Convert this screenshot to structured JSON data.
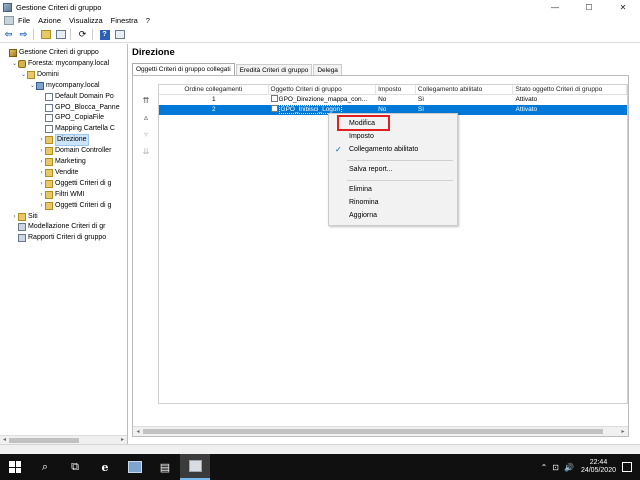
{
  "window": {
    "title": "Gestione Criteri di gruppo",
    "controls": {
      "minimize": "—",
      "maximize": "☐",
      "close": "✕"
    }
  },
  "menu": [
    "File",
    "Azione",
    "Visualizza",
    "Finestra",
    "?"
  ],
  "toolbar": {
    "icons": [
      "back-arrow-icon",
      "forward-arrow-icon",
      "up-folder-icon",
      "console-tree-icon",
      "refresh-icon",
      "help-icon",
      "show-hide-icon"
    ],
    "back": "⇦",
    "forward": "⇨",
    "help": "?"
  },
  "tree": [
    {
      "label": "Gestione Criteri di gruppo",
      "icon": "gpmc-root-icon",
      "expand": "",
      "level": 0
    },
    {
      "label": "Foresta: mycompany.local",
      "icon": "forest-icon",
      "expand": "⌄",
      "level": 1
    },
    {
      "label": "Domini",
      "icon": "folder-icon",
      "expand": "⌄",
      "level": 2
    },
    {
      "label": "mycompany.local",
      "icon": "domain-icon",
      "expand": "⌄",
      "level": 3
    },
    {
      "label": "Default Domain Po",
      "icon": "gpo-link-icon",
      "expand": "",
      "level": 4
    },
    {
      "label": "GPO_Blocca_Panne",
      "icon": "gpo-link-icon",
      "expand": "",
      "level": 4
    },
    {
      "label": "GPO_CopiaFile",
      "icon": "gpo-link-icon",
      "expand": "",
      "level": 4
    },
    {
      "label": "Mapping Cartella C",
      "icon": "gpo-link-icon",
      "expand": "",
      "level": 4
    },
    {
      "label": "Direzione",
      "icon": "ou-icon",
      "expand": "›",
      "level": 4,
      "selected": true
    },
    {
      "label": "Domain Controller",
      "icon": "ou-icon",
      "expand": "›",
      "level": 4
    },
    {
      "label": "Marketing",
      "icon": "ou-icon",
      "expand": "›",
      "level": 4
    },
    {
      "label": "Vendite",
      "icon": "ou-icon",
      "expand": "›",
      "level": 4
    },
    {
      "label": "Oggetti Criteri di g",
      "icon": "folder-icon",
      "expand": "›",
      "level": 4
    },
    {
      "label": "Filtri WMI",
      "icon": "wmi-folder-icon",
      "expand": "›",
      "level": 4
    },
    {
      "label": "Oggetti Criteri di g",
      "icon": "folder-icon",
      "expand": "›",
      "level": 4
    },
    {
      "label": "Siti",
      "icon": "sites-icon",
      "expand": "›",
      "level": 1
    },
    {
      "label": "Modellazione Criteri di gr",
      "icon": "modeling-icon",
      "expand": "",
      "level": 1
    },
    {
      "label": "Rapporti Criteri di gruppo",
      "icon": "report-icon",
      "expand": "",
      "level": 1
    }
  ],
  "right": {
    "heading": "Direzione",
    "tabs": [
      "Oggetti Criteri di gruppo collegati",
      "Eredità Criteri di gruppo",
      "Delega"
    ],
    "columns": [
      "Ordine collegamenti",
      "Oggetto Criteri di gruppo",
      "Imposto",
      "Collegamento abilitato",
      "Stato oggetto Criteri di gruppo"
    ],
    "rows": [
      {
        "order": "1",
        "gpo": "GPO_Direzione_mappa_con...",
        "enforced": "No",
        "link_enabled": "Sì",
        "status": "Attivato",
        "selected": false
      },
      {
        "order": "2",
        "gpo": "GPO_Inibisci_Logon",
        "enforced": "No",
        "link_enabled": "Sì",
        "status": "Attivato",
        "selected": true
      }
    ],
    "side_arrows": {
      "top": "⇈",
      "up": "▵",
      "down": "▿",
      "bottom": "⇊"
    }
  },
  "context_menu": {
    "items": [
      {
        "label": "Modifica",
        "checked": false
      },
      {
        "label": "Imposto",
        "checked": false
      },
      {
        "label": "Collegamento abilitato",
        "checked": true
      },
      {
        "label": "Salva report...",
        "checked": false
      },
      {
        "label": "Elimina",
        "checked": false
      },
      {
        "label": "Rinomina",
        "checked": false
      },
      {
        "label": "Aggiorna",
        "checked": false
      }
    ],
    "check_glyph": "✓"
  },
  "taskbar": {
    "icons": [
      "start-icon",
      "search-icon",
      "task-view-icon",
      "internet-explorer-icon",
      "server-manager-icon",
      "file-explorer-icon",
      "group-policy-icon"
    ],
    "search_glyph": "⌕",
    "taskview_glyph": "⧉",
    "ie_glyph": "e",
    "explorer_glyph": "▤",
    "tray": {
      "up": "⌃",
      "volume": "🔊",
      "network": "⊡"
    },
    "time": "22:44",
    "date": "24/05/2020"
  },
  "colors": {
    "selection": "#0078d7",
    "highlight_box": "#e02020",
    "taskbar": "#101010"
  }
}
